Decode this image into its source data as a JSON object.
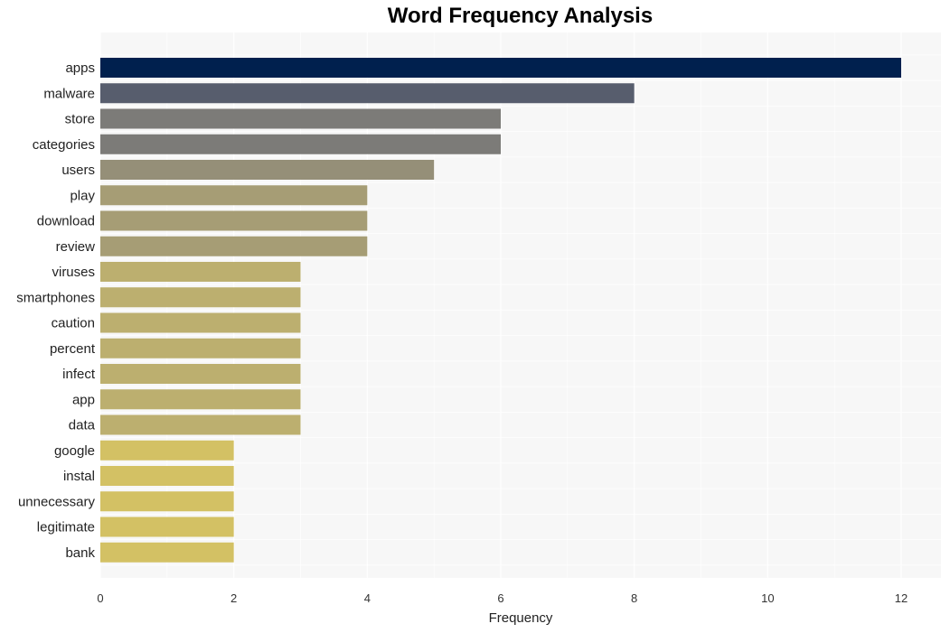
{
  "chart_data": {
    "type": "bar",
    "orientation": "horizontal",
    "title": "Word Frequency Analysis",
    "xlabel": "Frequency",
    "ylabel": "",
    "xlim": [
      0,
      12.6
    ],
    "xticks": [
      0,
      2,
      4,
      6,
      8,
      10,
      12
    ],
    "grid": true,
    "categories": [
      "apps",
      "malware",
      "store",
      "categories",
      "users",
      "play",
      "download",
      "review",
      "viruses",
      "smartphones",
      "caution",
      "percent",
      "infect",
      "app",
      "data",
      "google",
      "instal",
      "unnecessary",
      "legitimate",
      "bank"
    ],
    "values": [
      12,
      8,
      6,
      6,
      5,
      4,
      4,
      4,
      3,
      3,
      3,
      3,
      3,
      3,
      3,
      2,
      2,
      2,
      2,
      2
    ],
    "colors": [
      "#00204e",
      "#575d6d",
      "#7c7b78",
      "#7c7b78",
      "#958f78",
      "#a69d75",
      "#a69d75",
      "#a69d75",
      "#bcaf6f",
      "#bcaf6f",
      "#bcaf6f",
      "#bcaf6f",
      "#bcaf6f",
      "#bcaf6f",
      "#bcaf6f",
      "#d3c164",
      "#d3c164",
      "#d3c164",
      "#d3c164",
      "#d3c164"
    ],
    "plot_background": "#f7f7f7",
    "grid_color": "#ffffff"
  }
}
